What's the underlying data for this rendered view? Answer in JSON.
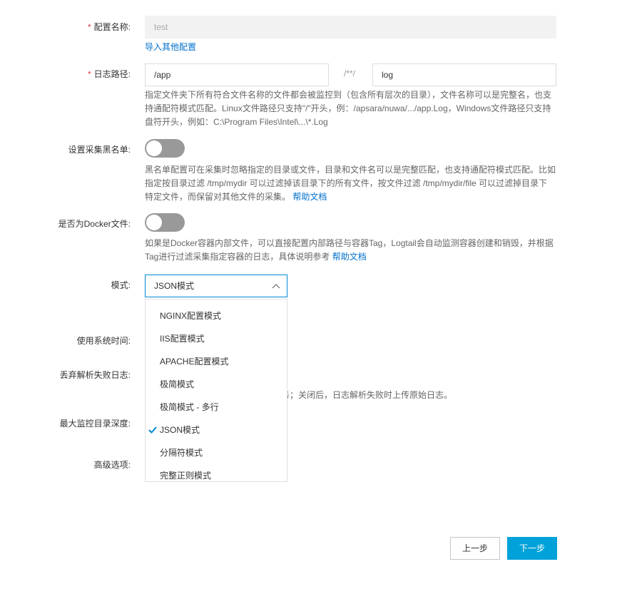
{
  "form": {
    "config_name": {
      "label": "配置名称:",
      "required_mark": "*",
      "value": "test",
      "import_link": "导入其他配置"
    },
    "log_path": {
      "label": "日志路径:",
      "required_mark": "*",
      "dir_value": "/app",
      "separator": "/**/",
      "file_value": "log",
      "help": [
        "指定文件夹下所有符合文件名称的文件都会被监控到（包含所有层次的目录），文件名称可以是完整名，也支",
        "持通配符模式匹配。Linux文件路径只支持\"/\"开头，例：/apsara/nuwa/.../app.Log，Windows文件路径只支持",
        "盘符开头，例如：C:\\Program Files\\Intel\\...\\*.Log"
      ]
    },
    "blacklist": {
      "label": "设置采集黑名单:",
      "enabled": false,
      "help": [
        "黑名单配置可在采集时忽略指定的目录或文件，目录和文件名可以是完整匹配，也支持通配符模式匹配。比如",
        "指定按目录过滤 /tmp/mydir 可以过滤掉该目录下的所有文件，按文件过滤 /tmp/mydir/file 可以过滤掉目录下",
        "特定文件，而保留对其他文件的采集。"
      ],
      "help_link": "帮助文档"
    },
    "docker": {
      "label": "是否为Docker文件:",
      "enabled": false,
      "help": [
        "如果是Docker容器内部文件，可以直接配置内部路径与容器Tag，Logtail会自动监测容器创建和销毁，并根据",
        "Tag进行过滤采集指定容器的日志，具体说明参考"
      ],
      "help_link": "帮助文档"
    },
    "mode": {
      "label": "模式:",
      "selected": "JSON模式",
      "options": [
        "NGINX配置模式",
        "IIS配置模式",
        "APACHE配置模式",
        "极简模式",
        "极简模式 - 多行",
        "JSON模式",
        "分隔符模式",
        "完整正则模式"
      ],
      "selected_index": 5
    },
    "system_time": {
      "label": "使用系统时间:"
    },
    "discard_failed": {
      "label": "丢弃解析失败日志:",
      "help_partial": "志服务；关闭后，日志解析失败时上传原始日志。"
    },
    "max_depth": {
      "label": "最大监控目录深度:"
    },
    "advanced": {
      "label": "高级选项:"
    }
  },
  "buttons": {
    "prev": "上一步",
    "next": "下一步"
  },
  "colors": {
    "accent": "#0087d3",
    "primary_button": "#00a2d9",
    "toggle_off": "#999999",
    "link": "#0070cc",
    "required": "#e4393c"
  }
}
